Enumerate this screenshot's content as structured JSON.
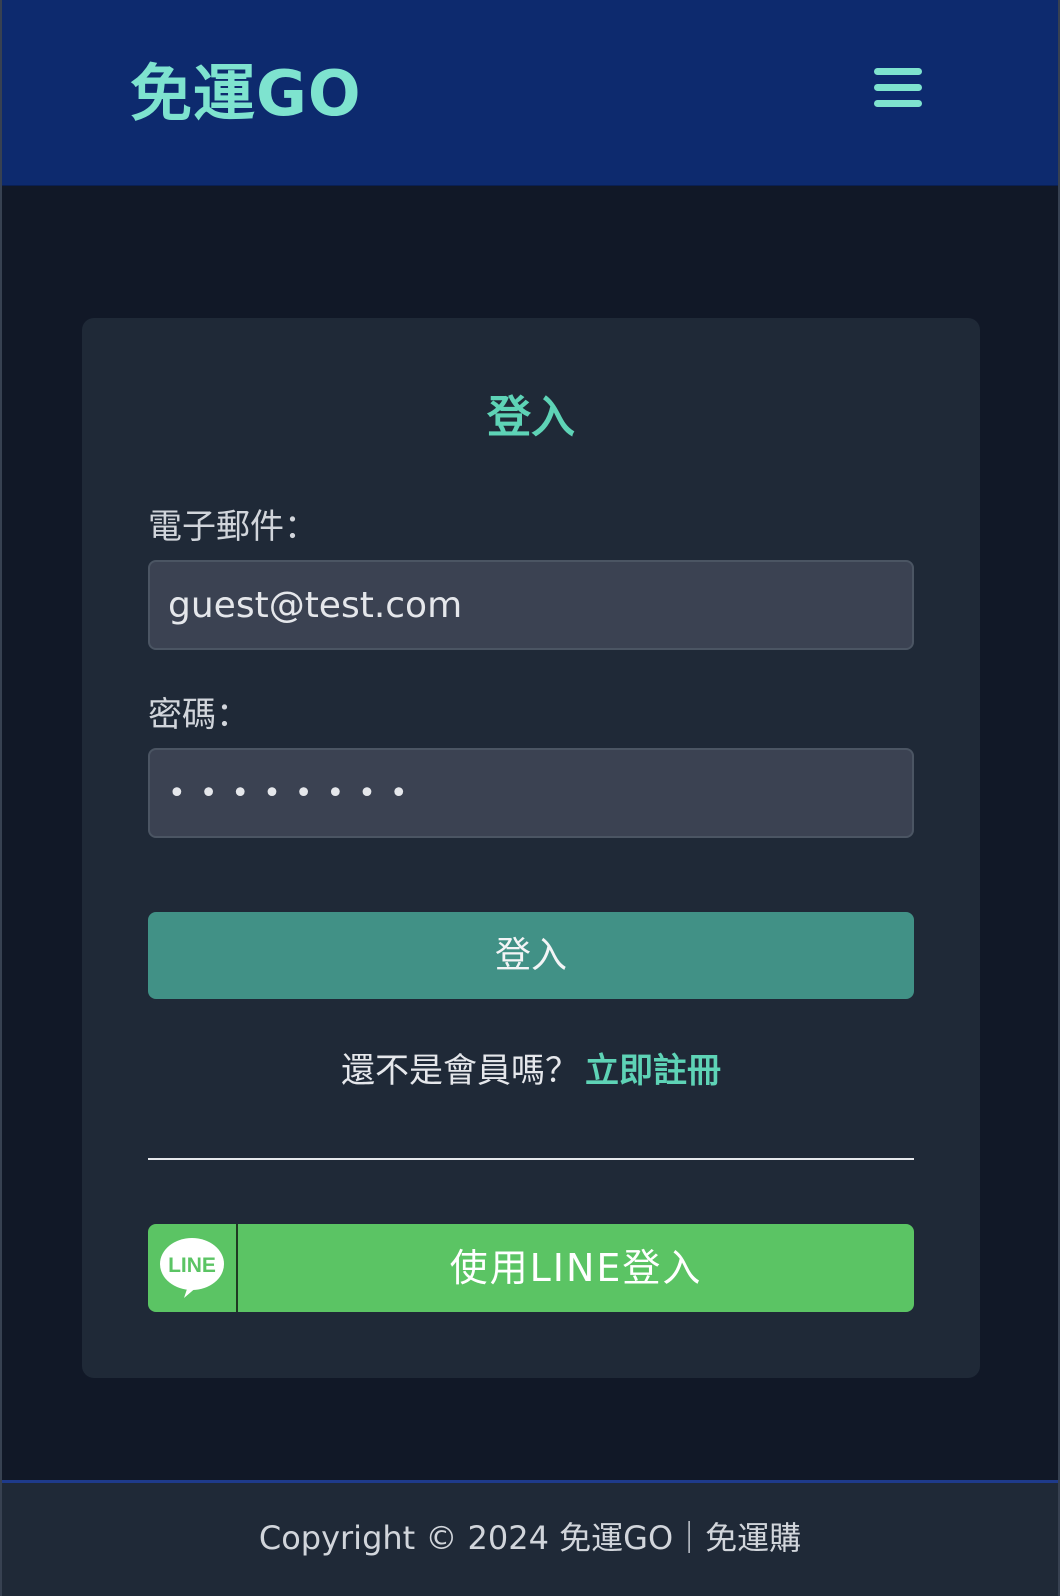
{
  "header": {
    "brand": "免運GO",
    "menu_icon": "hamburger-menu-icon"
  },
  "login_card": {
    "title": "登入",
    "email_label": "電子郵件：",
    "email_value": "guest@test.com",
    "password_label": "密碼：",
    "password_value": "••••••••",
    "submit_label": "登入",
    "register_prompt": "還不是會員嗎？",
    "register_link": "立即註冊",
    "line_icon": "line-logo-icon",
    "line_logo_text": "LINE",
    "line_login_label": "使用LINE登入"
  },
  "footer": {
    "copyright": "Copyright © 2024 免運GO｜免運購"
  },
  "colors": {
    "header_bg": "#0d2a6e",
    "accent": "#5ed3b6",
    "login_button": "#419186",
    "line_green": "#5bc464",
    "page_bg": "#111827",
    "card_bg": "#1f2937"
  }
}
